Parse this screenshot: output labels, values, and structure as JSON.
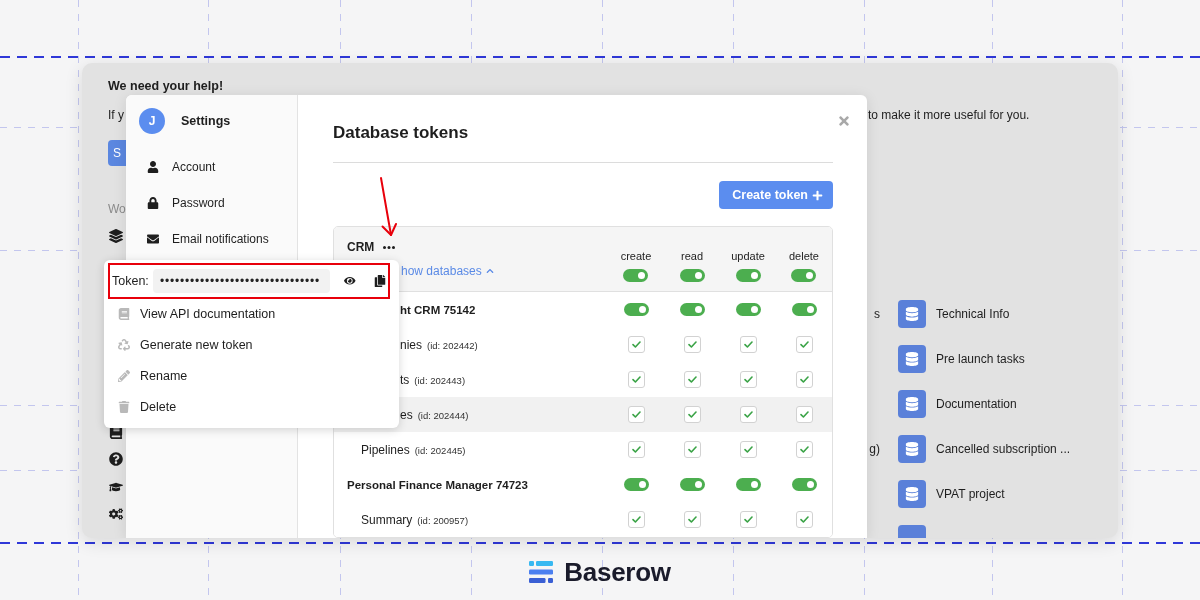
{
  "background_app": {
    "notice_title": "We need your help!",
    "notice_text_start": "If y",
    "notice_text_end": "to make it more useful for you.",
    "notice_button": "S",
    "section_label": "Wo",
    "cut_texts": [
      "s",
      "g)"
    ],
    "databases": [
      {
        "name": "Technical Info"
      },
      {
        "name": "Pre launch tasks"
      },
      {
        "name": "Documentation"
      },
      {
        "name": "Cancelled subscription ..."
      },
      {
        "name": "VPAT project"
      }
    ]
  },
  "settings_modal": {
    "avatar_initial": "J",
    "title": "Settings",
    "nav": [
      {
        "label": "Account"
      },
      {
        "label": "Password"
      },
      {
        "label": "Email notifications"
      }
    ],
    "heading": "Database tokens",
    "create_button": "Create token",
    "token": {
      "name": "CRM",
      "toggle_databases": "how databases",
      "columns": [
        {
          "label": "create",
          "on": true
        },
        {
          "label": "read",
          "on": true
        },
        {
          "label": "update",
          "on": true
        },
        {
          "label": "delete",
          "on": true
        }
      ],
      "rows": [
        {
          "name": "ht CRM 75142",
          "hovered": false,
          "permissions": [
            {
              "on": true
            },
            {
              "on": true
            },
            {
              "on": true
            },
            {
              "on": true
            }
          ],
          "children": [
            {
              "name": "nies",
              "id": "(id: 202442)",
              "hovered": false,
              "permissions": [
                {
                  "checked": true
                },
                {
                  "checked": true
                },
                {
                  "checked": true
                },
                {
                  "checked": true
                }
              ]
            },
            {
              "name": "ts",
              "id": "(id: 202443)",
              "hovered": false,
              "permissions": [
                {
                  "checked": true
                },
                {
                  "checked": true
                },
                {
                  "checked": true
                },
                {
                  "checked": true
                }
              ]
            },
            {
              "name": "es",
              "id": "(id: 202444)",
              "hovered": true,
              "permissions": [
                {
                  "checked": true
                },
                {
                  "checked": true
                },
                {
                  "checked": true
                },
                {
                  "checked": true
                }
              ]
            },
            {
              "name": "Pipelines",
              "id": "(id: 202445)",
              "hovered": false,
              "permissions": [
                {
                  "checked": true
                },
                {
                  "checked": true
                },
                {
                  "checked": true
                },
                {
                  "checked": true
                }
              ]
            }
          ]
        },
        {
          "name": "Personal Finance Manager 74723",
          "hovered": false,
          "permissions": [
            {
              "on": true
            },
            {
              "on": true
            },
            {
              "on": true
            },
            {
              "on": true
            }
          ],
          "children": [
            {
              "name": "Summary",
              "id": "(id: 200957)",
              "hovered": false,
              "permissions": [
                {
                  "checked": true
                },
                {
                  "checked": true
                },
                {
                  "checked": true
                },
                {
                  "checked": true
                }
              ]
            }
          ]
        }
      ]
    }
  },
  "token_menu": {
    "label": "Token:",
    "value": "••••••••••••••••••••••••••••••••",
    "items": [
      {
        "label": "View API documentation"
      },
      {
        "label": "Generate new token"
      },
      {
        "label": "Rename"
      },
      {
        "label": "Delete"
      }
    ]
  },
  "footer": {
    "logo_text": "Baserow"
  }
}
